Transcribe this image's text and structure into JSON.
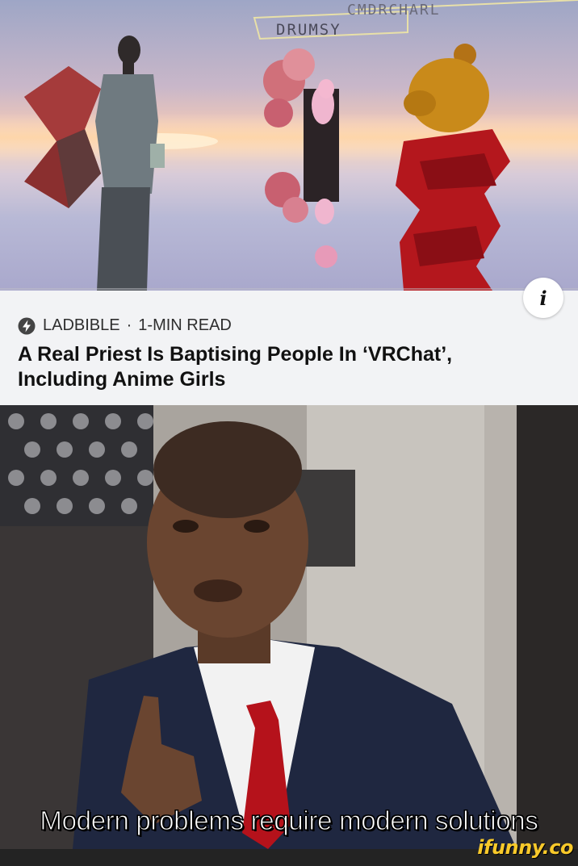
{
  "vr_image": {
    "name_tag_1": "DRUMSY",
    "name_tag_2": "CMDRCHARL"
  },
  "article": {
    "source": "LADBIBLE",
    "separator": "·",
    "read_time": "1-MIN READ",
    "headline": "A Real Priest Is Baptising People In ‘VRChat’, Including Anime Girls",
    "info_icon": "info-icon",
    "info_label": "i"
  },
  "meme": {
    "caption": "Modern problems require modern solutions"
  },
  "footer": {
    "watermark": "ifunny.co"
  },
  "colors": {
    "card_bg": "#f2f3f5",
    "watermark": "#f8c92a",
    "footer_bg": "#232323"
  }
}
